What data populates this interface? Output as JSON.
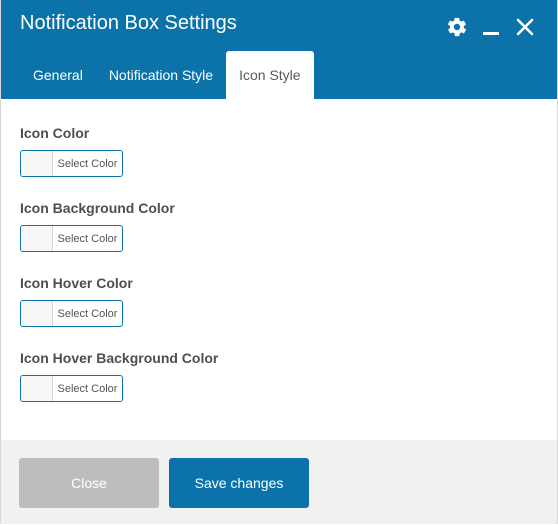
{
  "dialog": {
    "title": "Notification Box Settings",
    "controls": {
      "settings_icon": "gear-icon",
      "minimize_icon": "minimize-icon",
      "close_icon": "close-icon"
    }
  },
  "tabs": [
    {
      "label": "General",
      "active": false
    },
    {
      "label": "Notification Style",
      "active": false
    },
    {
      "label": "Icon Style",
      "active": true
    }
  ],
  "fields": [
    {
      "label": "Icon Color",
      "button_label": "Select Color"
    },
    {
      "label": "Icon Background Color",
      "button_label": "Select Color"
    },
    {
      "label": "Icon Hover Color",
      "button_label": "Select Color"
    },
    {
      "label": "Icon Hover Background Color",
      "button_label": "Select Color"
    }
  ],
  "footer": {
    "close_label": "Close",
    "save_label": "Save changes"
  },
  "colors": {
    "accent": "#0b73aa",
    "disabled_button": "#bdbdbd",
    "footer_bg": "#f1f1f1"
  }
}
